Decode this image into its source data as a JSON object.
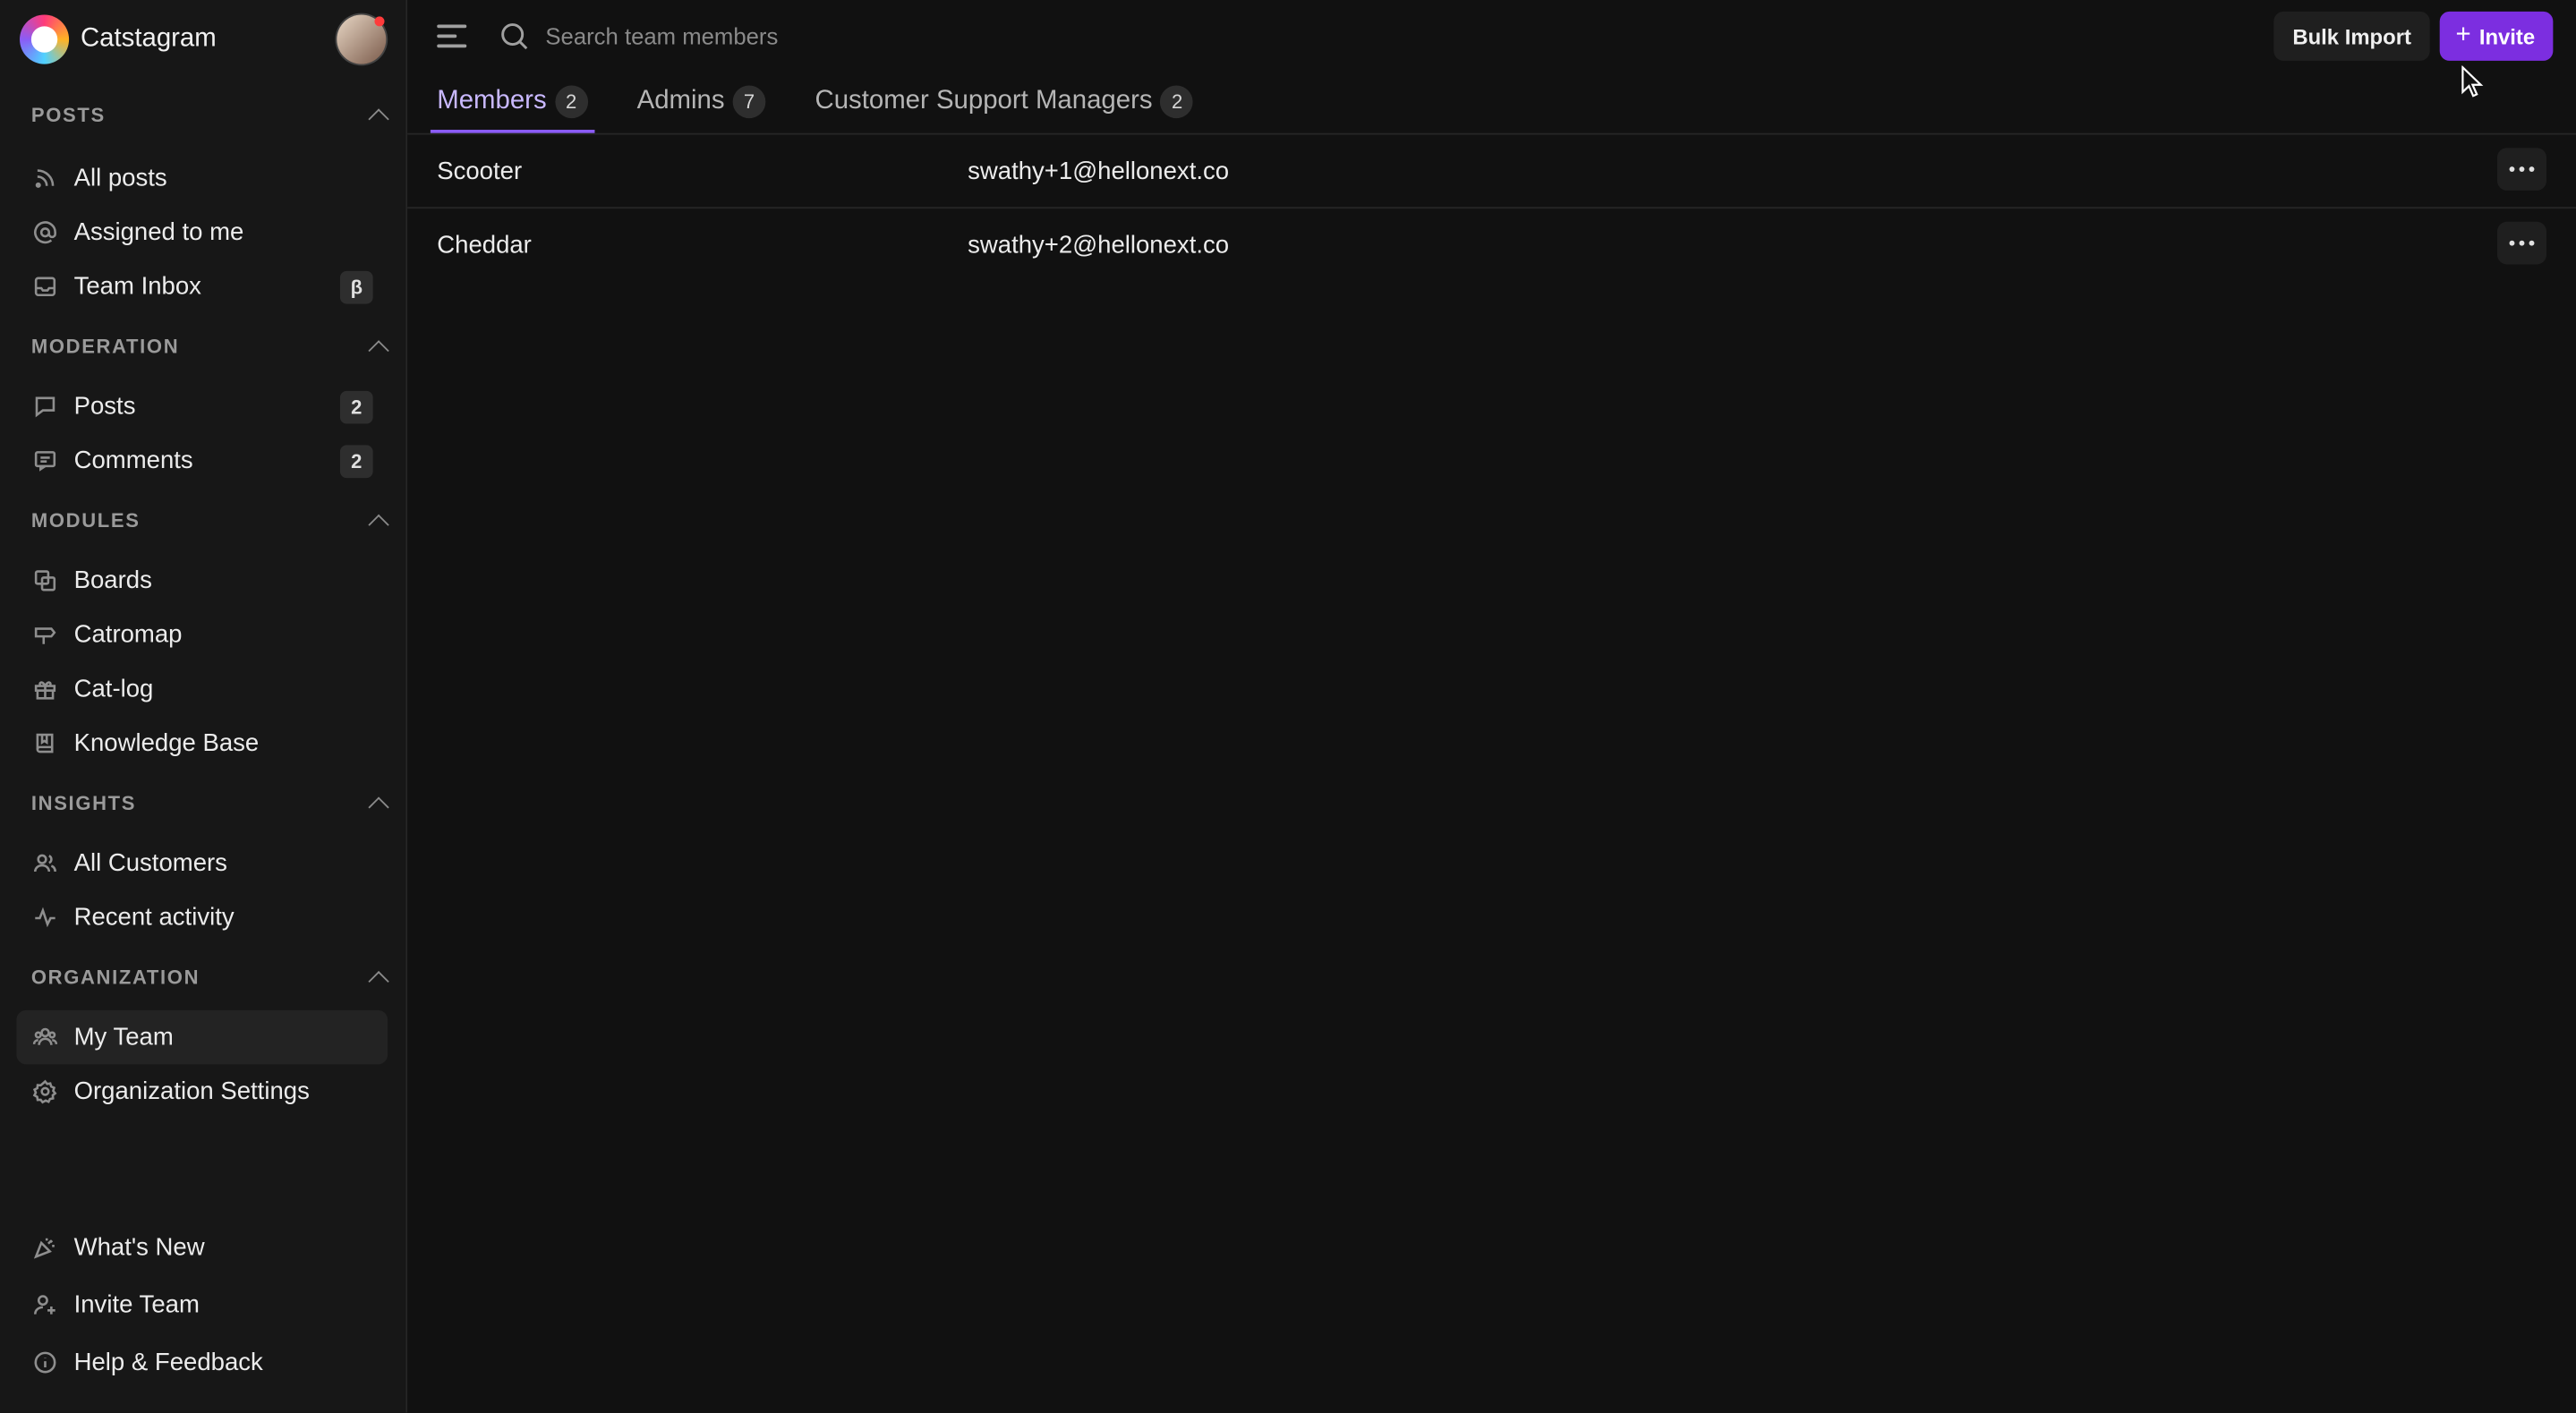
{
  "app": {
    "name": "Catstagram"
  },
  "sidebar": {
    "sections": [
      {
        "title": "POSTS",
        "items": [
          {
            "label": "All posts",
            "icon": "rss-icon"
          },
          {
            "label": "Assigned to me",
            "icon": "at-icon"
          },
          {
            "label": "Team Inbox",
            "icon": "inbox-icon",
            "badge": "β"
          }
        ]
      },
      {
        "title": "MODERATION",
        "items": [
          {
            "label": "Posts",
            "icon": "post-icon",
            "badge": "2"
          },
          {
            "label": "Comments",
            "icon": "comment-icon",
            "badge": "2"
          }
        ]
      },
      {
        "title": "MODULES",
        "items": [
          {
            "label": "Boards",
            "icon": "boards-icon"
          },
          {
            "label": "Catromap",
            "icon": "signpost-icon"
          },
          {
            "label": "Cat-log",
            "icon": "gift-icon"
          },
          {
            "label": "Knowledge Base",
            "icon": "book-icon"
          }
        ]
      },
      {
        "title": "INSIGHTS",
        "items": [
          {
            "label": "All Customers",
            "icon": "users-icon"
          },
          {
            "label": "Recent activity",
            "icon": "activity-icon"
          }
        ]
      },
      {
        "title": "ORGANIZATION",
        "items": [
          {
            "label": "My Team",
            "icon": "team-icon",
            "active": true
          },
          {
            "label": "Organization Settings",
            "icon": "gear-icon"
          }
        ]
      }
    ],
    "bottom": [
      {
        "label": "What's New",
        "icon": "party-icon"
      },
      {
        "label": "Invite Team",
        "icon": "user-plus-icon"
      },
      {
        "label": "Help & Feedback",
        "icon": "info-icon"
      }
    ]
  },
  "topbar": {
    "search_placeholder": "Search team members",
    "bulk_import_label": "Bulk Import",
    "invite_label": "Invite",
    "invite_plus": "+"
  },
  "tabs": [
    {
      "label": "Members",
      "count": "2",
      "active": true
    },
    {
      "label": "Admins",
      "count": "7"
    },
    {
      "label": "Customer Support Managers",
      "count": "2"
    }
  ],
  "members": [
    {
      "name": "Scooter",
      "email": "swathy+1@hellonext.co"
    },
    {
      "name": "Cheddar",
      "email": "swathy+2@hellonext.co"
    }
  ],
  "colors": {
    "accent": "#7c2ee0",
    "tab_active": "#c9b8ff",
    "background": "#111111"
  }
}
